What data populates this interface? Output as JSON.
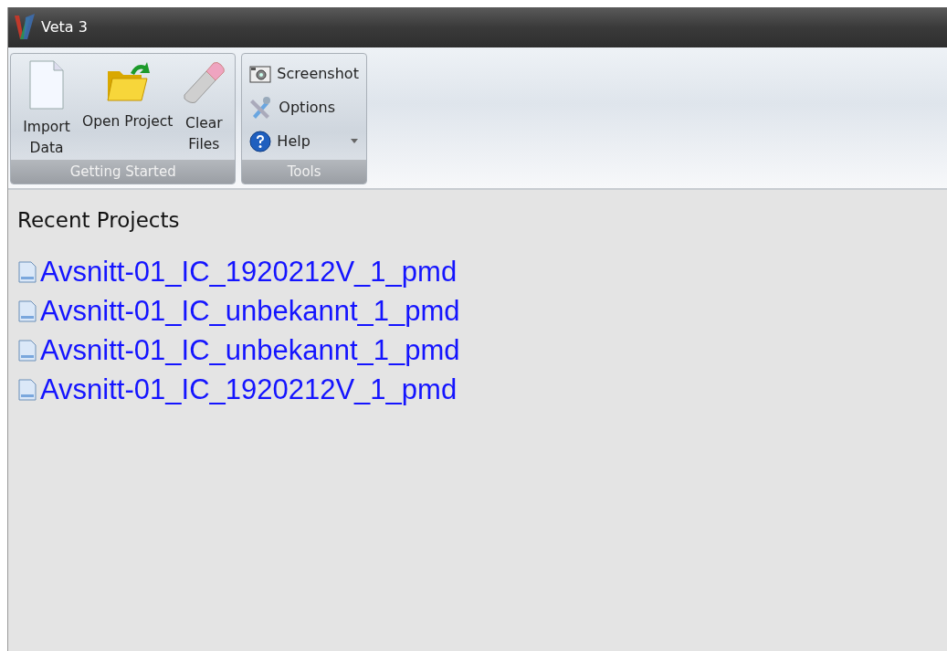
{
  "window": {
    "title": "Veta 3"
  },
  "ribbon": {
    "groups": [
      {
        "label": "Getting Started",
        "kind": "large",
        "buttons": [
          {
            "label": "Import Data"
          },
          {
            "label": "Open Project"
          },
          {
            "label": "Clear Files"
          }
        ]
      },
      {
        "label": "Tools",
        "kind": "small",
        "buttons": [
          {
            "label": "Screenshot",
            "dropdown": false
          },
          {
            "label": "Options",
            "dropdown": false
          },
          {
            "label": "Help",
            "dropdown": true
          }
        ]
      }
    ]
  },
  "recent_projects": {
    "title": "Recent Projects",
    "items": [
      "Avsnitt-01_IC_1920212V_1_pmd",
      "Avsnitt-01_IC_unbekannt_1_pmd",
      "Avsnitt-01_IC_unbekannt_1_pmd",
      "Avsnitt-01_IC_1920212V_1_pmd"
    ]
  }
}
